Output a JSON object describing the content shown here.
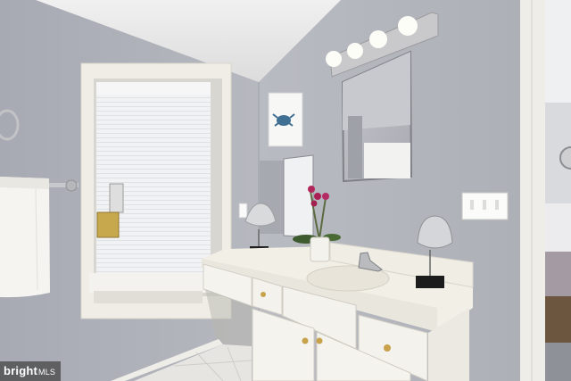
{
  "watermark": {
    "text": "bright",
    "suffix": "MLS"
  },
  "palette": {
    "wall": "#aeb1b9",
    "ceiling": "#e9e9ea",
    "window_trim": "#efede6",
    "vanity": "#f4f3ee",
    "countertop": "#f1eee6",
    "floor": "#e6e5e2",
    "hardware": "#c8a24a"
  }
}
